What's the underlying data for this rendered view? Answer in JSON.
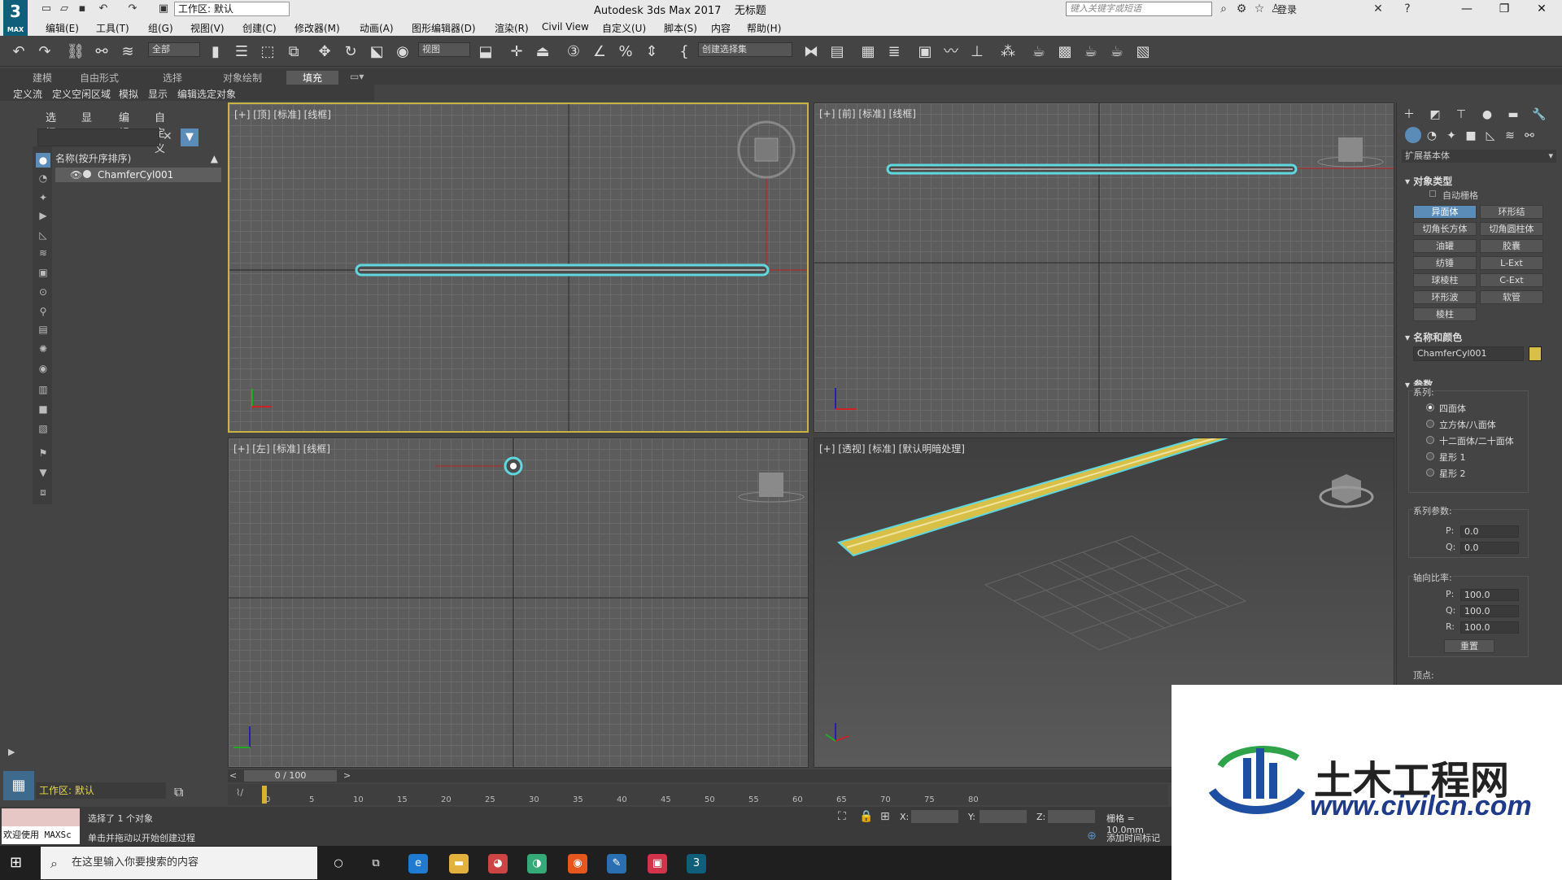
{
  "window": {
    "app_title": "Autodesk 3ds Max 2017",
    "doc_title": "无标题",
    "workspace": "工作区: 默认",
    "search_placeholder": "键入关键字或短语",
    "login": "登录",
    "logo": "3",
    "logo_sub": "MAX"
  },
  "menu": [
    "编辑(E)",
    "工具(T)",
    "组(G)",
    "视图(V)",
    "创建(C)",
    "修改器(M)",
    "动画(A)",
    "图形编辑器(D)",
    "渲染(R)",
    "Civil View",
    "自定义(U)",
    "脚本(S)",
    "内容",
    "帮助(H)"
  ],
  "toolbar": {
    "filter": "全部",
    "refcoord": "视图",
    "selset": "创建选择集"
  },
  "ribbon": {
    "tabs": [
      "建模",
      "自由形式",
      "选择",
      "对象绘制",
      "填充"
    ],
    "sub": [
      "定义流",
      "定义空闲区域",
      "模拟",
      "显示",
      "编辑选定对象"
    ]
  },
  "scene_explorer": {
    "menus": [
      "选择",
      "显示",
      "编辑",
      "自定义"
    ],
    "header": "名称(按升序排序)",
    "object": "ChamferCyl001",
    "workspace": "工作区: 默认"
  },
  "viewports": {
    "top": "[+] [顶] [标准] [线框]",
    "front": "[+] [前] [标准] [线框]",
    "left": "[+] [左] [标准] [线框]",
    "persp": "[+] [透视] [标准] [默认明暗处理]"
  },
  "command_panel": {
    "category": "扩展基本体",
    "object_type": "对象类型",
    "autogrid": "自动栅格",
    "buttons": [
      "异面体",
      "环形结",
      "切角长方体",
      "切角圆柱体",
      "油罐",
      "胶囊",
      "纺锤",
      "L-Ext",
      "球棱柱",
      "C-Ext",
      "环形波",
      "软管",
      "棱柱"
    ],
    "name_color": "名称和颜色",
    "name": "ChamferCyl001",
    "obj_color": "#d8c048",
    "params": "参数",
    "family": "系列:",
    "families": [
      "四面体",
      "立方体/八面体",
      "十二面体/二十面体",
      "星形 1",
      "星形 2"
    ],
    "family_params": "系列参数:",
    "p_label": "P:",
    "p": "0.0",
    "q_label": "Q:",
    "q": "0.0",
    "axis_ratio": "轴向比率:",
    "ap_label": "P:",
    "ap": "100.0",
    "aq_label": "Q:",
    "aq": "100.0",
    "ar_label": "R:",
    "ar": "100.0",
    "reset": "重置",
    "vertex": "顶点:"
  },
  "timeline": {
    "frame": "0 / 100",
    "ticks": [
      "0",
      "5",
      "10",
      "15",
      "20",
      "25",
      "30",
      "35",
      "40",
      "45",
      "50",
      "55",
      "60",
      "65",
      "70",
      "75",
      "80"
    ],
    "progress": 0
  },
  "status": {
    "welcome": "欢迎使用 MAXSc",
    "selected": "选择了 1 个对象",
    "hint": "单击并拖动以开始创建过程",
    "x_label": "X:",
    "y_label": "Y:",
    "z_label": "Z:",
    "grid": "栅格 = 10.0mm",
    "addtime": "添加时间标记"
  },
  "taskbar": {
    "search": "在这里输入你要搜索的内容"
  },
  "watermark": {
    "title": "土木工程网",
    "url": "www.civilcn.com"
  }
}
